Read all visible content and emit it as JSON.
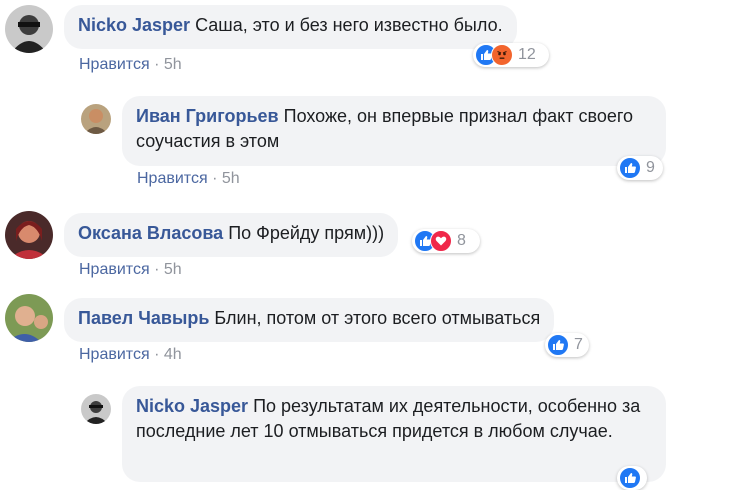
{
  "comments": [
    {
      "author": "Nicko Jasper",
      "text": "Саша, это и без него известно было.",
      "like_label": "Нравится",
      "separator": "·",
      "time": "5h",
      "reaction_count": "12",
      "reactions": [
        "like-icon",
        "angry-icon"
      ]
    },
    {
      "author": "Иван Григорьев",
      "text": "Похоже, он впервые признал факт своего соучастия в этом",
      "like_label": "Нравится",
      "separator": "·",
      "time": "5h",
      "reaction_count": "9",
      "reactions": [
        "like-icon"
      ]
    },
    {
      "author": "Оксана Власова",
      "text": "По Фрейду прям)))",
      "like_label": "Нравится",
      "separator": "·",
      "time": "5h",
      "reaction_count": "8",
      "reactions": [
        "like-icon",
        "love-icon"
      ]
    },
    {
      "author": "Павел Чавырь",
      "text": "Блин, потом от этого всего отмываться",
      "like_label": "Нравится",
      "separator": "·",
      "time": "4h",
      "reaction_count": "7",
      "reactions": [
        "like-icon"
      ]
    },
    {
      "author": "Nicko Jasper",
      "text": "По результатам их деятельности, особенно за последние лет 10 отмываться придется в любом случае.",
      "reactions": [
        "like-icon"
      ]
    }
  ],
  "colors": {
    "author": "#385898",
    "bubble": "#f2f3f5",
    "meta": "#90949c",
    "like": "#2078f4",
    "angry": "#f2642d",
    "love": "#f0284a"
  }
}
